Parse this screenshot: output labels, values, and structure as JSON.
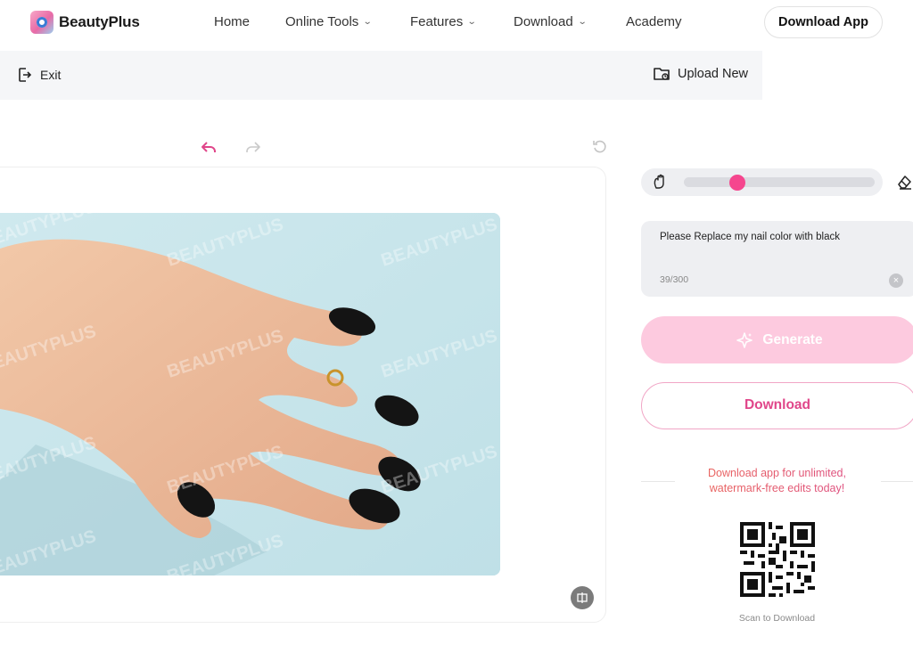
{
  "brand": {
    "name": "BeautyPlus"
  },
  "nav": {
    "items": [
      {
        "label": "Home",
        "has_menu": false
      },
      {
        "label": "Online Tools",
        "has_menu": true
      },
      {
        "label": "Features",
        "has_menu": true
      },
      {
        "label": "Download",
        "has_menu": true
      },
      {
        "label": "Academy",
        "has_menu": false
      }
    ],
    "cta": "Download App"
  },
  "subbar": {
    "exit_label": "Exit",
    "upload_label": "Upload New"
  },
  "editor": {
    "watermark": "BEAUTYPLUS",
    "brush_size_fraction": 0.28
  },
  "prompt": {
    "value": "Please Replace my nail color with black",
    "count": "39/300"
  },
  "actions": {
    "generate": "Generate",
    "download": "Download"
  },
  "promo": {
    "line1": "Download app for unlimited,",
    "line2": "watermark-free edits today!",
    "scan": "Scan to Download"
  },
  "colors": {
    "accent": "#f5468e",
    "generate_bg": "#fdcadf",
    "download_text": "#e0468a"
  }
}
